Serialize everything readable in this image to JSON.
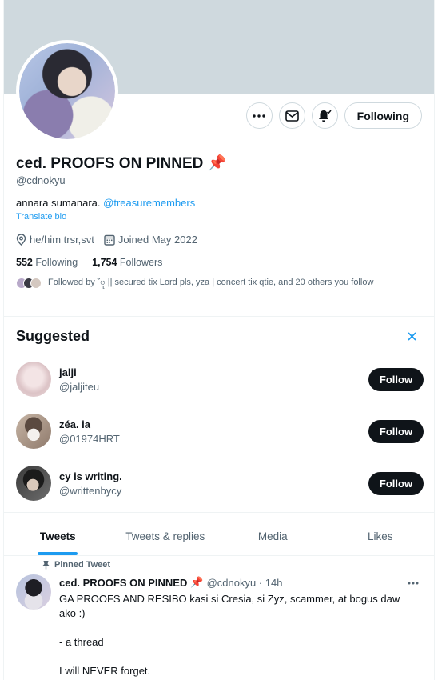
{
  "profile": {
    "name": "ced. PROOFS ON PINNED",
    "name_emoji": "📌",
    "handle": "@cdnokyu",
    "bio_text": "annara sumanara.",
    "bio_mention": "@treasuremembers",
    "translate": "Translate bio",
    "location": "he/him trsr,svt",
    "joined": "Joined May 2022",
    "following_count": "552",
    "following_label": "Following",
    "followers_count": "1,754",
    "followers_label": "Followers",
    "followed_by": "Followed by ˘ဗူ || secured tix Lord pls, yza | concert tix qtie, and 20 others you follow"
  },
  "actions": {
    "more_icon": "more-icon",
    "message_icon": "envelope-icon",
    "notify_icon": "bell-check-icon",
    "following_label": "Following"
  },
  "suggested": {
    "title": "Suggested",
    "close_icon": "close-icon",
    "items": [
      {
        "name": "jalji",
        "handle": "@jaljiteu",
        "button": "Follow",
        "color": "#e8d4d6"
      },
      {
        "name": "zéa. ia",
        "handle": "@01974HRT",
        "button": "Follow",
        "color": "#bca99b"
      },
      {
        "name": "cy is writing.",
        "handle": "@writtenbycy",
        "button": "Follow",
        "color": "#2b2b2b"
      }
    ]
  },
  "tabs": [
    {
      "label": "Tweets",
      "active": true
    },
    {
      "label": "Tweets & replies",
      "active": false
    },
    {
      "label": "Media",
      "active": false
    },
    {
      "label": "Likes",
      "active": false
    }
  ],
  "tweet": {
    "pinned_label": "Pinned Tweet",
    "name": "ced. PROOFS ON PINNED",
    "name_emoji": "📌",
    "handle_time": "@cdnokyu · 14h",
    "body": [
      "GA PROOFS AND RESIBO kasi si Cresia, si Zyz, scammer, at bogus daw ako :)",
      "- a thread",
      "I will NEVER forget."
    ]
  }
}
